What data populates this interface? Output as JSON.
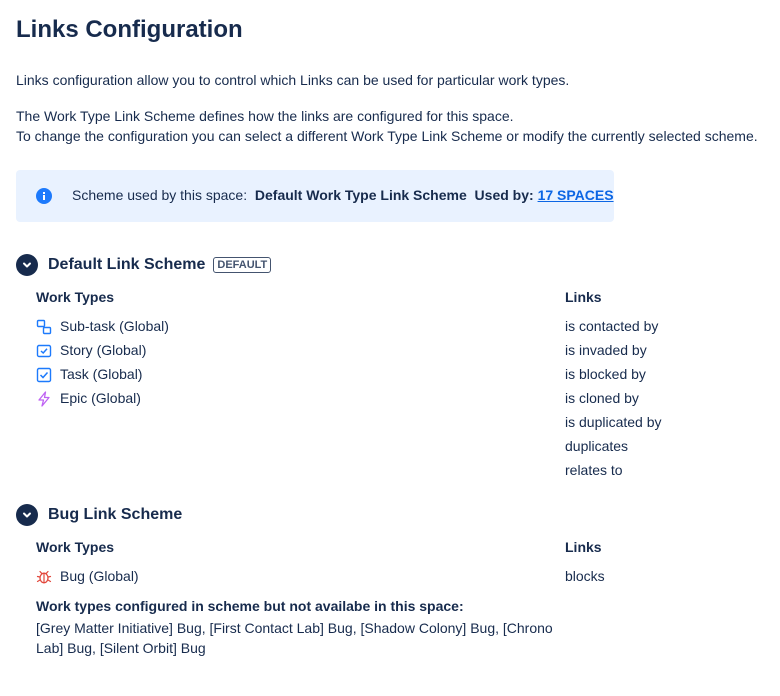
{
  "page": {
    "title": "Links Configuration",
    "intro": "Links configuration allow you to control which Links can be used for particular work types.",
    "line2": "The Work Type Link Scheme defines how the links are configured for this space.",
    "line3": "To change the configuration you can select a different Work Type Link Scheme or modify the currently selected scheme."
  },
  "banner": {
    "label": "Scheme used by this space:",
    "scheme": "Default Work Type Link Scheme",
    "used_by_label": "Used by:",
    "used_by_link": "17 SPACES"
  },
  "schemes": [
    {
      "name": "Default Link Scheme",
      "badge": "DEFAULT",
      "work_types_header": "Work Types",
      "links_header": "Links",
      "work_types": [
        {
          "label": "Sub-task (Global)",
          "icon": "subtask-icon"
        },
        {
          "label": "Story (Global)",
          "icon": "story-icon"
        },
        {
          "label": "Task (Global)",
          "icon": "task-icon"
        },
        {
          "label": "Epic (Global)",
          "icon": "epic-icon"
        }
      ],
      "links": [
        "is contacted by",
        "is invaded by",
        "is blocked by",
        "is cloned by",
        "is duplicated by",
        "duplicates",
        "relates to"
      ]
    },
    {
      "name": "Bug Link Scheme",
      "work_types_header": "Work Types",
      "links_header": "Links",
      "work_types": [
        {
          "label": "Bug (Global)",
          "icon": "bug-icon"
        }
      ],
      "links": [
        "blocks"
      ],
      "note_title": "Work types configured in scheme but not availabe in this space:",
      "note_text": "[Grey Matter Initiative] Bug, [First Contact Lab] Bug, [Shadow Colony] Bug, [Chrono Lab] Bug, [Silent Orbit] Bug"
    }
  ],
  "colors": {
    "accent": "#0c66e4",
    "info": "#1d7afc",
    "banner_bg": "#e9f2ff",
    "bug": "#e2483d",
    "epic": "#bf63f3",
    "task": "#1d7afc"
  }
}
